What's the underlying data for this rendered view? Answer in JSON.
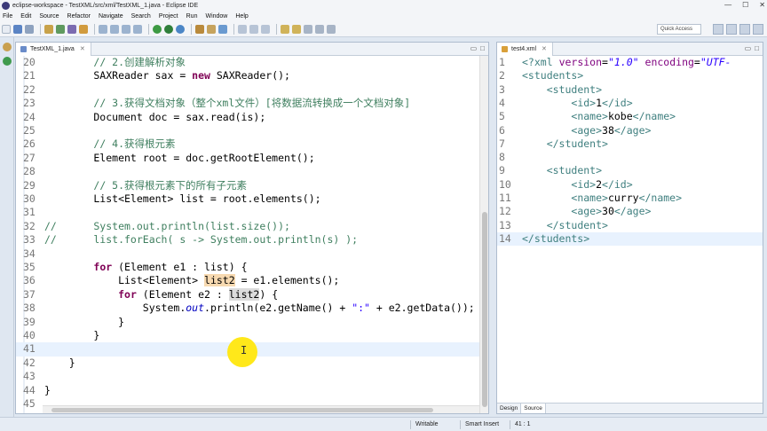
{
  "window": {
    "title": "eclipse-workspace - TestXML/src/xml/TestXML_1.java - Eclipse IDE",
    "controls": [
      "—",
      "☐",
      "✕"
    ]
  },
  "menu": [
    "File",
    "Edit",
    "Source",
    "Refactor",
    "Navigate",
    "Search",
    "Project",
    "Run",
    "Window",
    "Help"
  ],
  "toolbar": {
    "quick_access": "Quick Access"
  },
  "editor": {
    "tab_label": "TestXML_1.java",
    "lines": [
      {
        "n": "20",
        "html": "        <span class=\"cm\">// 2.创建解析对象</span>"
      },
      {
        "n": "21",
        "html": "        SAXReader sax = <span class=\"kw\">new</span> SAXReader();"
      },
      {
        "n": "22",
        "html": ""
      },
      {
        "n": "23",
        "html": "        <span class=\"cm\">// 3.获得文档对象（整个xml文件）[将数据流转换成一个文档对象]</span>"
      },
      {
        "n": "24",
        "html": "        Document doc = sax.read(is);"
      },
      {
        "n": "25",
        "html": ""
      },
      {
        "n": "26",
        "html": "        <span class=\"cm\">// 4.获得根元素</span>"
      },
      {
        "n": "27",
        "html": "        Element root = doc.getRootElement();"
      },
      {
        "n": "28",
        "html": ""
      },
      {
        "n": "29",
        "html": "        <span class=\"cm\">// 5.获得根元素下的所有子元素</span>"
      },
      {
        "n": "30",
        "html": "        List&lt;Element&gt; list = root.elements();"
      },
      {
        "n": "31",
        "html": ""
      },
      {
        "n": "32",
        "html": "<span class=\"cm\">//      System.out.println(list.size());</span>"
      },
      {
        "n": "33",
        "html": "<span class=\"cm\">//      list.forEach( s -&gt; System.out.println(s) );</span>"
      },
      {
        "n": "34",
        "html": ""
      },
      {
        "n": "35",
        "html": "        <span class=\"kw\">for</span> (Element e1 : list) {"
      },
      {
        "n": "36",
        "html": "            List&lt;Element&gt; <span class=\"hl\">list2</span> = e1.elements();"
      },
      {
        "n": "37",
        "html": "            <span class=\"kw\">for</span> (Element e2 : <span class=\"hl2\">list2</span>) {"
      },
      {
        "n": "38",
        "html": "                System.<span class=\"fld\">out</span>.println(e2.getName() + <span class=\"str\">\":\"</span> + e2.getData());"
      },
      {
        "n": "39",
        "html": "            }"
      },
      {
        "n": "40",
        "html": "        }"
      },
      {
        "n": "41",
        "html": ""
      },
      {
        "n": "42",
        "html": "    }"
      },
      {
        "n": "43",
        "html": ""
      },
      {
        "n": "44",
        "html": "}"
      },
      {
        "n": "45",
        "html": ""
      }
    ],
    "current_line": "41"
  },
  "xml_editor": {
    "tab_label": "test4.xml",
    "lines": [
      {
        "n": "1",
        "html": "<span class=\"pi\">&lt;?xml</span> <span class=\"attr\">version</span>=<span class=\"aval\">\"1.0\"</span> <span class=\"attr\">encoding</span>=<span class=\"aval\">\"UTF-</span>"
      },
      {
        "n": "2",
        "html": "<span class=\"tag\">&lt;students&gt;</span>"
      },
      {
        "n": "3",
        "html": "    <span class=\"tag\">&lt;student&gt;</span>"
      },
      {
        "n": "4",
        "html": "        <span class=\"tag\">&lt;id&gt;</span><span class=\"txt\">1</span><span class=\"tag\">&lt;/id&gt;</span>"
      },
      {
        "n": "5",
        "html": "        <span class=\"tag\">&lt;name&gt;</span><span class=\"txt\">kobe</span><span class=\"tag\">&lt;/name&gt;</span>"
      },
      {
        "n": "6",
        "html": "        <span class=\"tag\">&lt;age&gt;</span><span class=\"txt\">38</span><span class=\"tag\">&lt;/age&gt;</span>"
      },
      {
        "n": "7",
        "html": "    <span class=\"tag\">&lt;/student&gt;</span>"
      },
      {
        "n": "8",
        "html": ""
      },
      {
        "n": "9",
        "html": "    <span class=\"tag\">&lt;student&gt;</span>"
      },
      {
        "n": "10",
        "html": "        <span class=\"tag\">&lt;id&gt;</span><span class=\"txt\">2</span><span class=\"tag\">&lt;/id&gt;</span>"
      },
      {
        "n": "11",
        "html": "        <span class=\"tag\">&lt;name&gt;</span><span class=\"txt\">curry</span><span class=\"tag\">&lt;/name&gt;</span>"
      },
      {
        "n": "12",
        "html": "        <span class=\"tag\">&lt;age&gt;</span><span class=\"txt\">30</span><span class=\"tag\">&lt;/age&gt;</span>"
      },
      {
        "n": "13",
        "html": "    <span class=\"tag\">&lt;/student&gt;</span>"
      },
      {
        "n": "14",
        "html": "<span class=\"tag\">&lt;/students&gt;</span>"
      }
    ],
    "current_line": "14",
    "bottom_tabs": [
      "Design",
      "Source"
    ]
  },
  "status": {
    "writable": "Writable",
    "insert_mode": "Smart Insert",
    "position": "41 : 1"
  },
  "colors": {
    "keyword": "#7f0055",
    "comment": "#3f7f5f",
    "string": "#2a00ff",
    "current_line": "#e8f2fe",
    "occurrence": "#f7d9b0",
    "cursor_highlight": "#ffe81a"
  }
}
